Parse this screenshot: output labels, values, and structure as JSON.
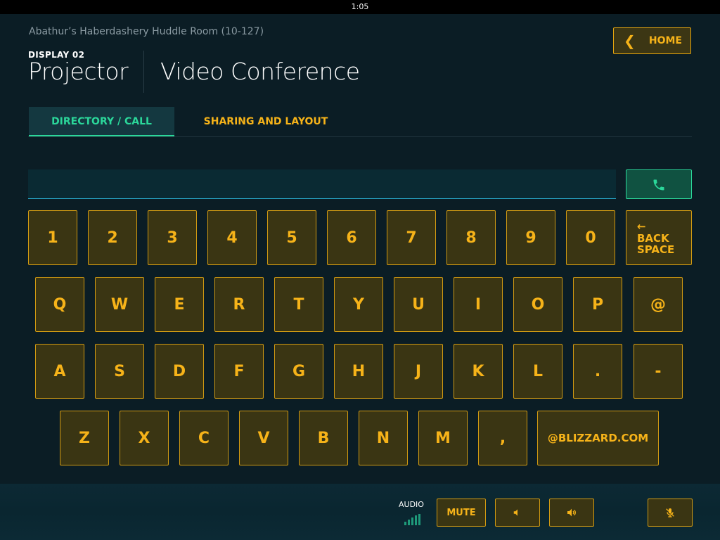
{
  "status_bar": {
    "time": "1:05"
  },
  "header": {
    "room_name": "Abathur’s Haberdashery Huddle Room (10-127)",
    "display_label": "DISPLAY 02",
    "source_title": "Projector",
    "mode_title": "Video Conference",
    "home_label": "HOME"
  },
  "tabs": [
    {
      "label": "DIRECTORY / CALL",
      "active": true
    },
    {
      "label": "SHARING AND LAYOUT",
      "active": false
    }
  ],
  "dial": {
    "value": "",
    "placeholder": ""
  },
  "keyboard": {
    "row1": [
      "1",
      "2",
      "3",
      "4",
      "5",
      "6",
      "7",
      "8",
      "9",
      "0"
    ],
    "backspace": {
      "line1": "BACK",
      "line2": "SPACE",
      "arrow": "🡐"
    },
    "row2": [
      "Q",
      "W",
      "E",
      "R",
      "T",
      "Y",
      "U",
      "I",
      "O",
      "P",
      "@"
    ],
    "row3": [
      "A",
      "S",
      "D",
      "F",
      "G",
      "H",
      "J",
      "K",
      "L",
      ".",
      "-"
    ],
    "row4": [
      "Z",
      "X",
      "C",
      "V",
      "B",
      "N",
      "M",
      ","
    ],
    "domain_key": "@BLIZZARD.COM"
  },
  "footer": {
    "audio_label": "AUDIO",
    "volume_level_bars": 5,
    "mute_label": "MUTE"
  },
  "colors": {
    "background": "#0b1d25",
    "accent_gold": "#f6b319",
    "accent_green": "#2bd79a",
    "key_fill": "#3a3513"
  },
  "icons": {
    "call": "phone-icon",
    "volume_down": "volume-down-icon",
    "volume_up": "volume-up-icon",
    "mic_mute": "mic-mute-icon",
    "home_chevron": "chevron-left-icon"
  }
}
